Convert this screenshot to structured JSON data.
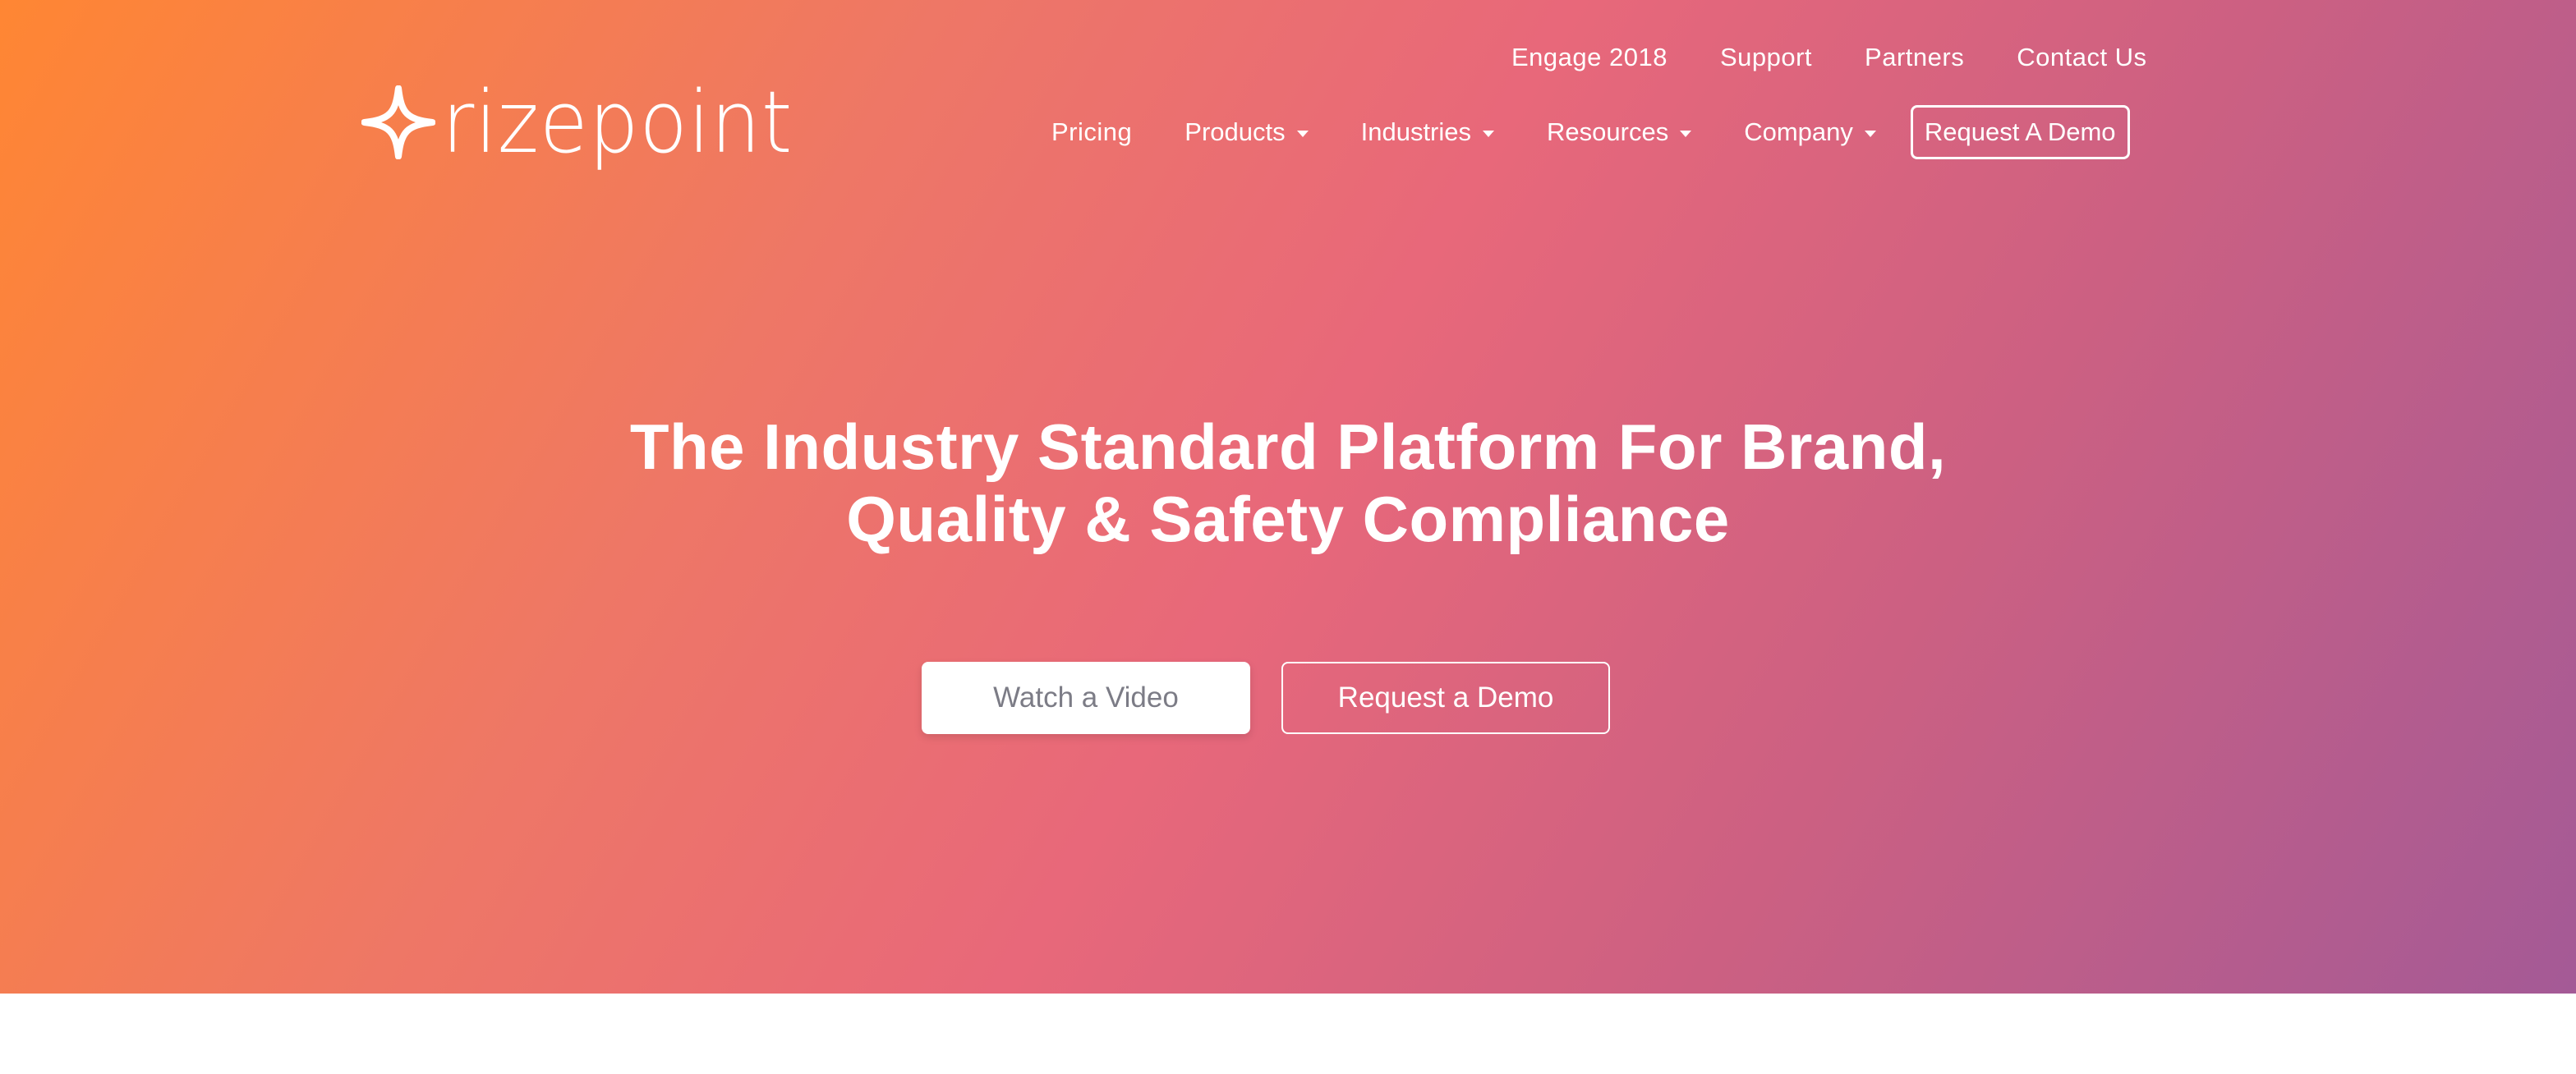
{
  "brand": {
    "logo_text": "rizepoint"
  },
  "utility_nav": [
    {
      "label": "Engage 2018"
    },
    {
      "label": "Support"
    },
    {
      "label": "Partners"
    },
    {
      "label": "Contact Us"
    }
  ],
  "main_nav": {
    "pricing": "Pricing",
    "products": "Products",
    "industries": "Industries",
    "resources": "Resources",
    "company": "Company",
    "request_demo": "Request A Demo"
  },
  "hero": {
    "headline_line1": "The Industry Standard Platform For Brand,",
    "headline_line2": "Quality & Safety Compliance",
    "watch_video": "Watch a Video",
    "request_demo": "Request a Demo"
  },
  "colors": {
    "gradient_start": "#ff8633",
    "gradient_mid": "#e8687a",
    "gradient_end": "#a45a96",
    "button_text_gray": "#7c7c86"
  },
  "icons": {
    "logo_mark": "four-point-star-icon",
    "dropdown": "caret-down-icon"
  }
}
